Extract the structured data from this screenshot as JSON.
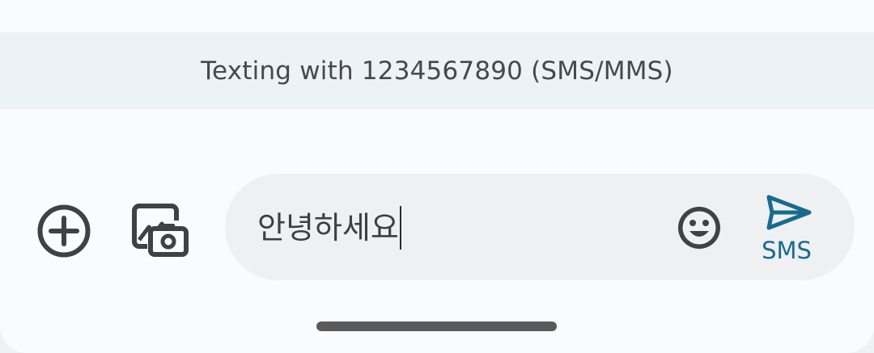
{
  "banner": {
    "text": "Texting with 1234567890 (SMS/MMS)"
  },
  "compose": {
    "value": "안녕하세요",
    "send_label": "SMS"
  },
  "icons": {
    "add": "add-circle-icon",
    "media": "gallery-camera-icon",
    "emoji": "emoji-icon",
    "send": "send-icon"
  },
  "colors": {
    "accent": "#186b8f",
    "icon": "#3d4246",
    "banner_bg": "#edf2f6",
    "field_bg": "#eff0f2"
  }
}
